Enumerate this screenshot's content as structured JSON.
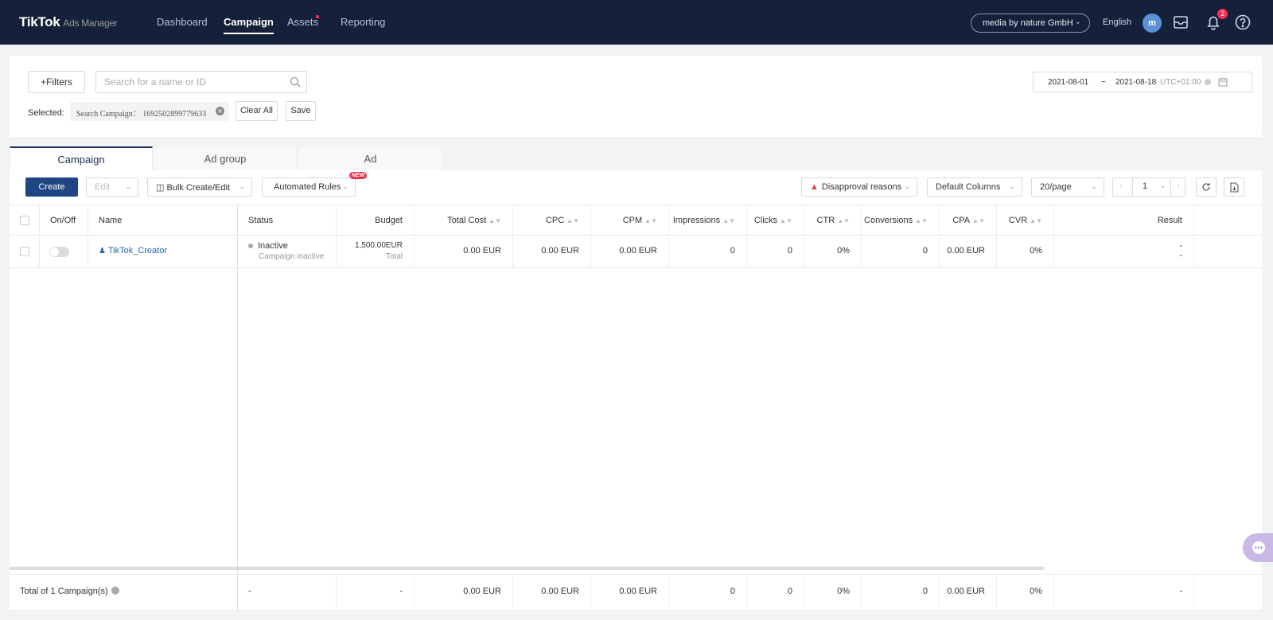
{
  "header": {
    "logo": "TikTok",
    "logo_sub": "Ads Manager",
    "nav": [
      "Dashboard",
      "Campaign",
      "Assets",
      "Reporting"
    ],
    "account": "media by nature GmbH",
    "language": "English",
    "avatar_letter": "m",
    "notification_count": "2"
  },
  "filters": {
    "filters_label": "Filters",
    "search_placeholder": "Search for a name or ID",
    "selected_label": "Selected:",
    "chip_text": "Search Campaign： 1692502899779633",
    "clear_all": "Clear All",
    "save": "Save",
    "date_start": "2021-08-01",
    "date_sep": "~",
    "date_end": "2021-08-18",
    "timezone": "UTC+01:00"
  },
  "tabs": [
    "Campaign",
    "Ad group",
    "Ad"
  ],
  "toolbar": {
    "create": "Create",
    "edit": "Edit",
    "bulk": "Bulk Create/Edit",
    "rules": "Automated Rules",
    "new_badge": "NEW",
    "disapproval": "Disapproval reasons",
    "columns": "Default Columns",
    "per_page": "20/page",
    "page": "1"
  },
  "table": {
    "columns": [
      "On/Off",
      "Name",
      "Status",
      "Budget",
      "Total Cost",
      "CPC",
      "CPM",
      "Impressions",
      "Clicks",
      "CTR",
      "Conversions",
      "CPA",
      "CVR",
      "Result"
    ],
    "row": {
      "name": "TikTok_Creator",
      "status": "Inactive",
      "status_sub": "Campaign inactive",
      "budget": "1,500.00EUR",
      "budget_sub": "Total",
      "total_cost": "0.00 EUR",
      "cpc": "0.00 EUR",
      "cpm": "0.00 EUR",
      "impressions": "0",
      "clicks": "0",
      "ctr": "0%",
      "conversions": "0",
      "cpa": "0.00 EUR",
      "cvr": "0%",
      "result_1": "-",
      "result_2": "-"
    },
    "footer": {
      "label": "Total of 1 Campaign(s)",
      "status": "-",
      "budget": "-",
      "total_cost": "0.00 EUR",
      "cpc": "0.00 EUR",
      "cpm": "0.00 EUR",
      "impressions": "0",
      "clicks": "0",
      "ctr": "0%",
      "conversions": "0",
      "cpa": "0.00 EUR",
      "cvr": "0%",
      "result": "-"
    }
  }
}
